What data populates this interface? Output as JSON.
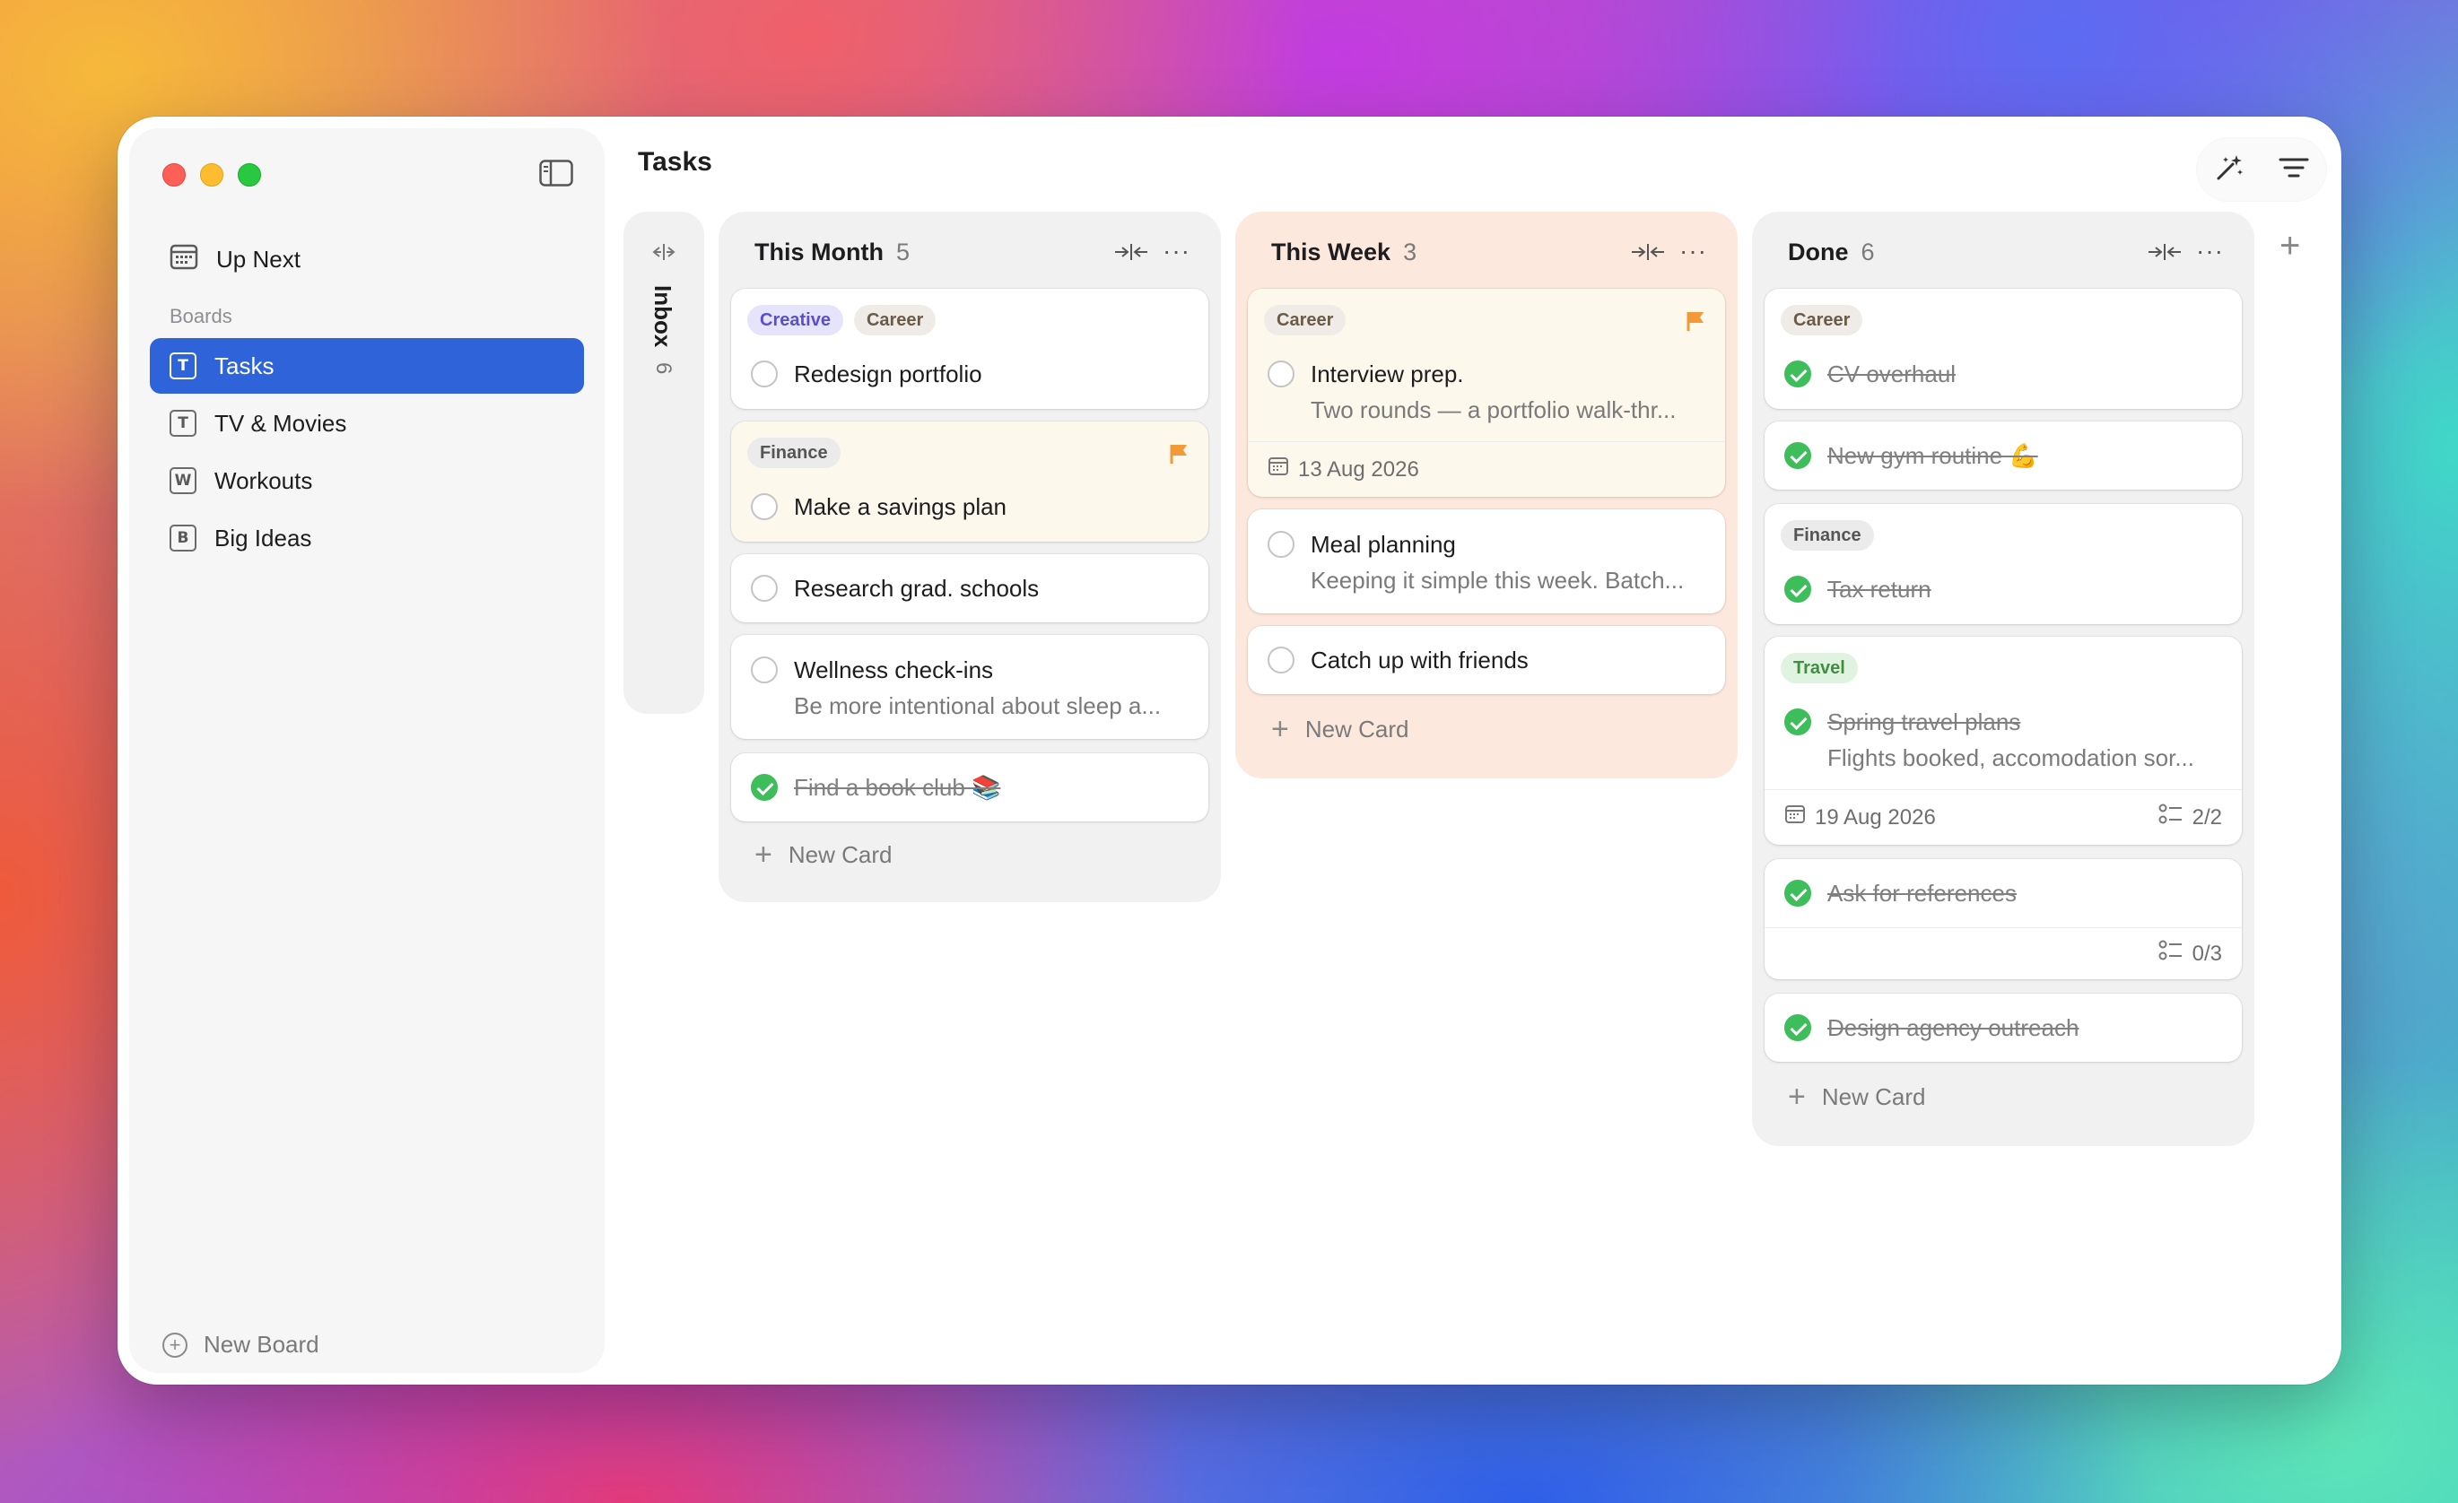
{
  "window": {
    "title": "Tasks"
  },
  "sidebar": {
    "up_next": "Up Next",
    "section_label": "Boards",
    "boards": [
      {
        "glyph": "T",
        "label": "Tasks",
        "active": true
      },
      {
        "glyph": "T",
        "label": "TV & Movies"
      },
      {
        "glyph": "W",
        "label": "Workouts"
      },
      {
        "glyph": "B",
        "label": "Big Ideas"
      }
    ],
    "new_board": "New Board"
  },
  "inbox": {
    "title": "Inbox",
    "count": "6"
  },
  "columns": [
    {
      "title": "This Month",
      "count": "5",
      "new_card": "New Card",
      "cards": [
        {
          "tags": [
            "Creative",
            "Career"
          ],
          "title": "Redesign portfolio"
        },
        {
          "tags": [
            "Finance"
          ],
          "title": "Make a savings plan",
          "flagged": true
        },
        {
          "title": "Research grad. schools"
        },
        {
          "title": "Wellness check-ins",
          "subtitle": "Be more intentional about sleep a..."
        },
        {
          "title": "Find a book club 📚",
          "done": true
        }
      ]
    },
    {
      "title": "This Week",
      "count": "3",
      "new_card": "New Card",
      "cards": [
        {
          "tags": [
            "Career"
          ],
          "title": "Interview prep.",
          "subtitle": "Two rounds — a portfolio walk-thr...",
          "date": "13 Aug 2026",
          "flagged": true
        },
        {
          "title": "Meal planning",
          "subtitle": "Keeping it simple this week. Batch..."
        },
        {
          "title": "Catch up with friends"
        }
      ]
    },
    {
      "title": "Done",
      "count": "6",
      "new_card": "New Card",
      "cards": [
        {
          "tags": [
            "Career"
          ],
          "title": "CV overhaul",
          "done": true
        },
        {
          "title": "New gym routine 💪",
          "done": true
        },
        {
          "tags": [
            "Finance"
          ],
          "title": "Tax return",
          "done": true
        },
        {
          "tags": [
            "Travel"
          ],
          "title": "Spring travel plans",
          "subtitle": "Flights booked, accomodation sor...",
          "date": "19 Aug 2026",
          "subtasks": "2/2",
          "done": true
        },
        {
          "title": "Ask for references",
          "subtasks": "0/3",
          "done": true
        },
        {
          "title": "Design agency outreach",
          "done": true
        }
      ]
    }
  ],
  "icons": {
    "toolbar": [
      "magic-wand-icon",
      "filter-icon"
    ],
    "accent": "#2f63d9",
    "flag_color": "#f29a38",
    "done_color": "#3ebd5b"
  }
}
